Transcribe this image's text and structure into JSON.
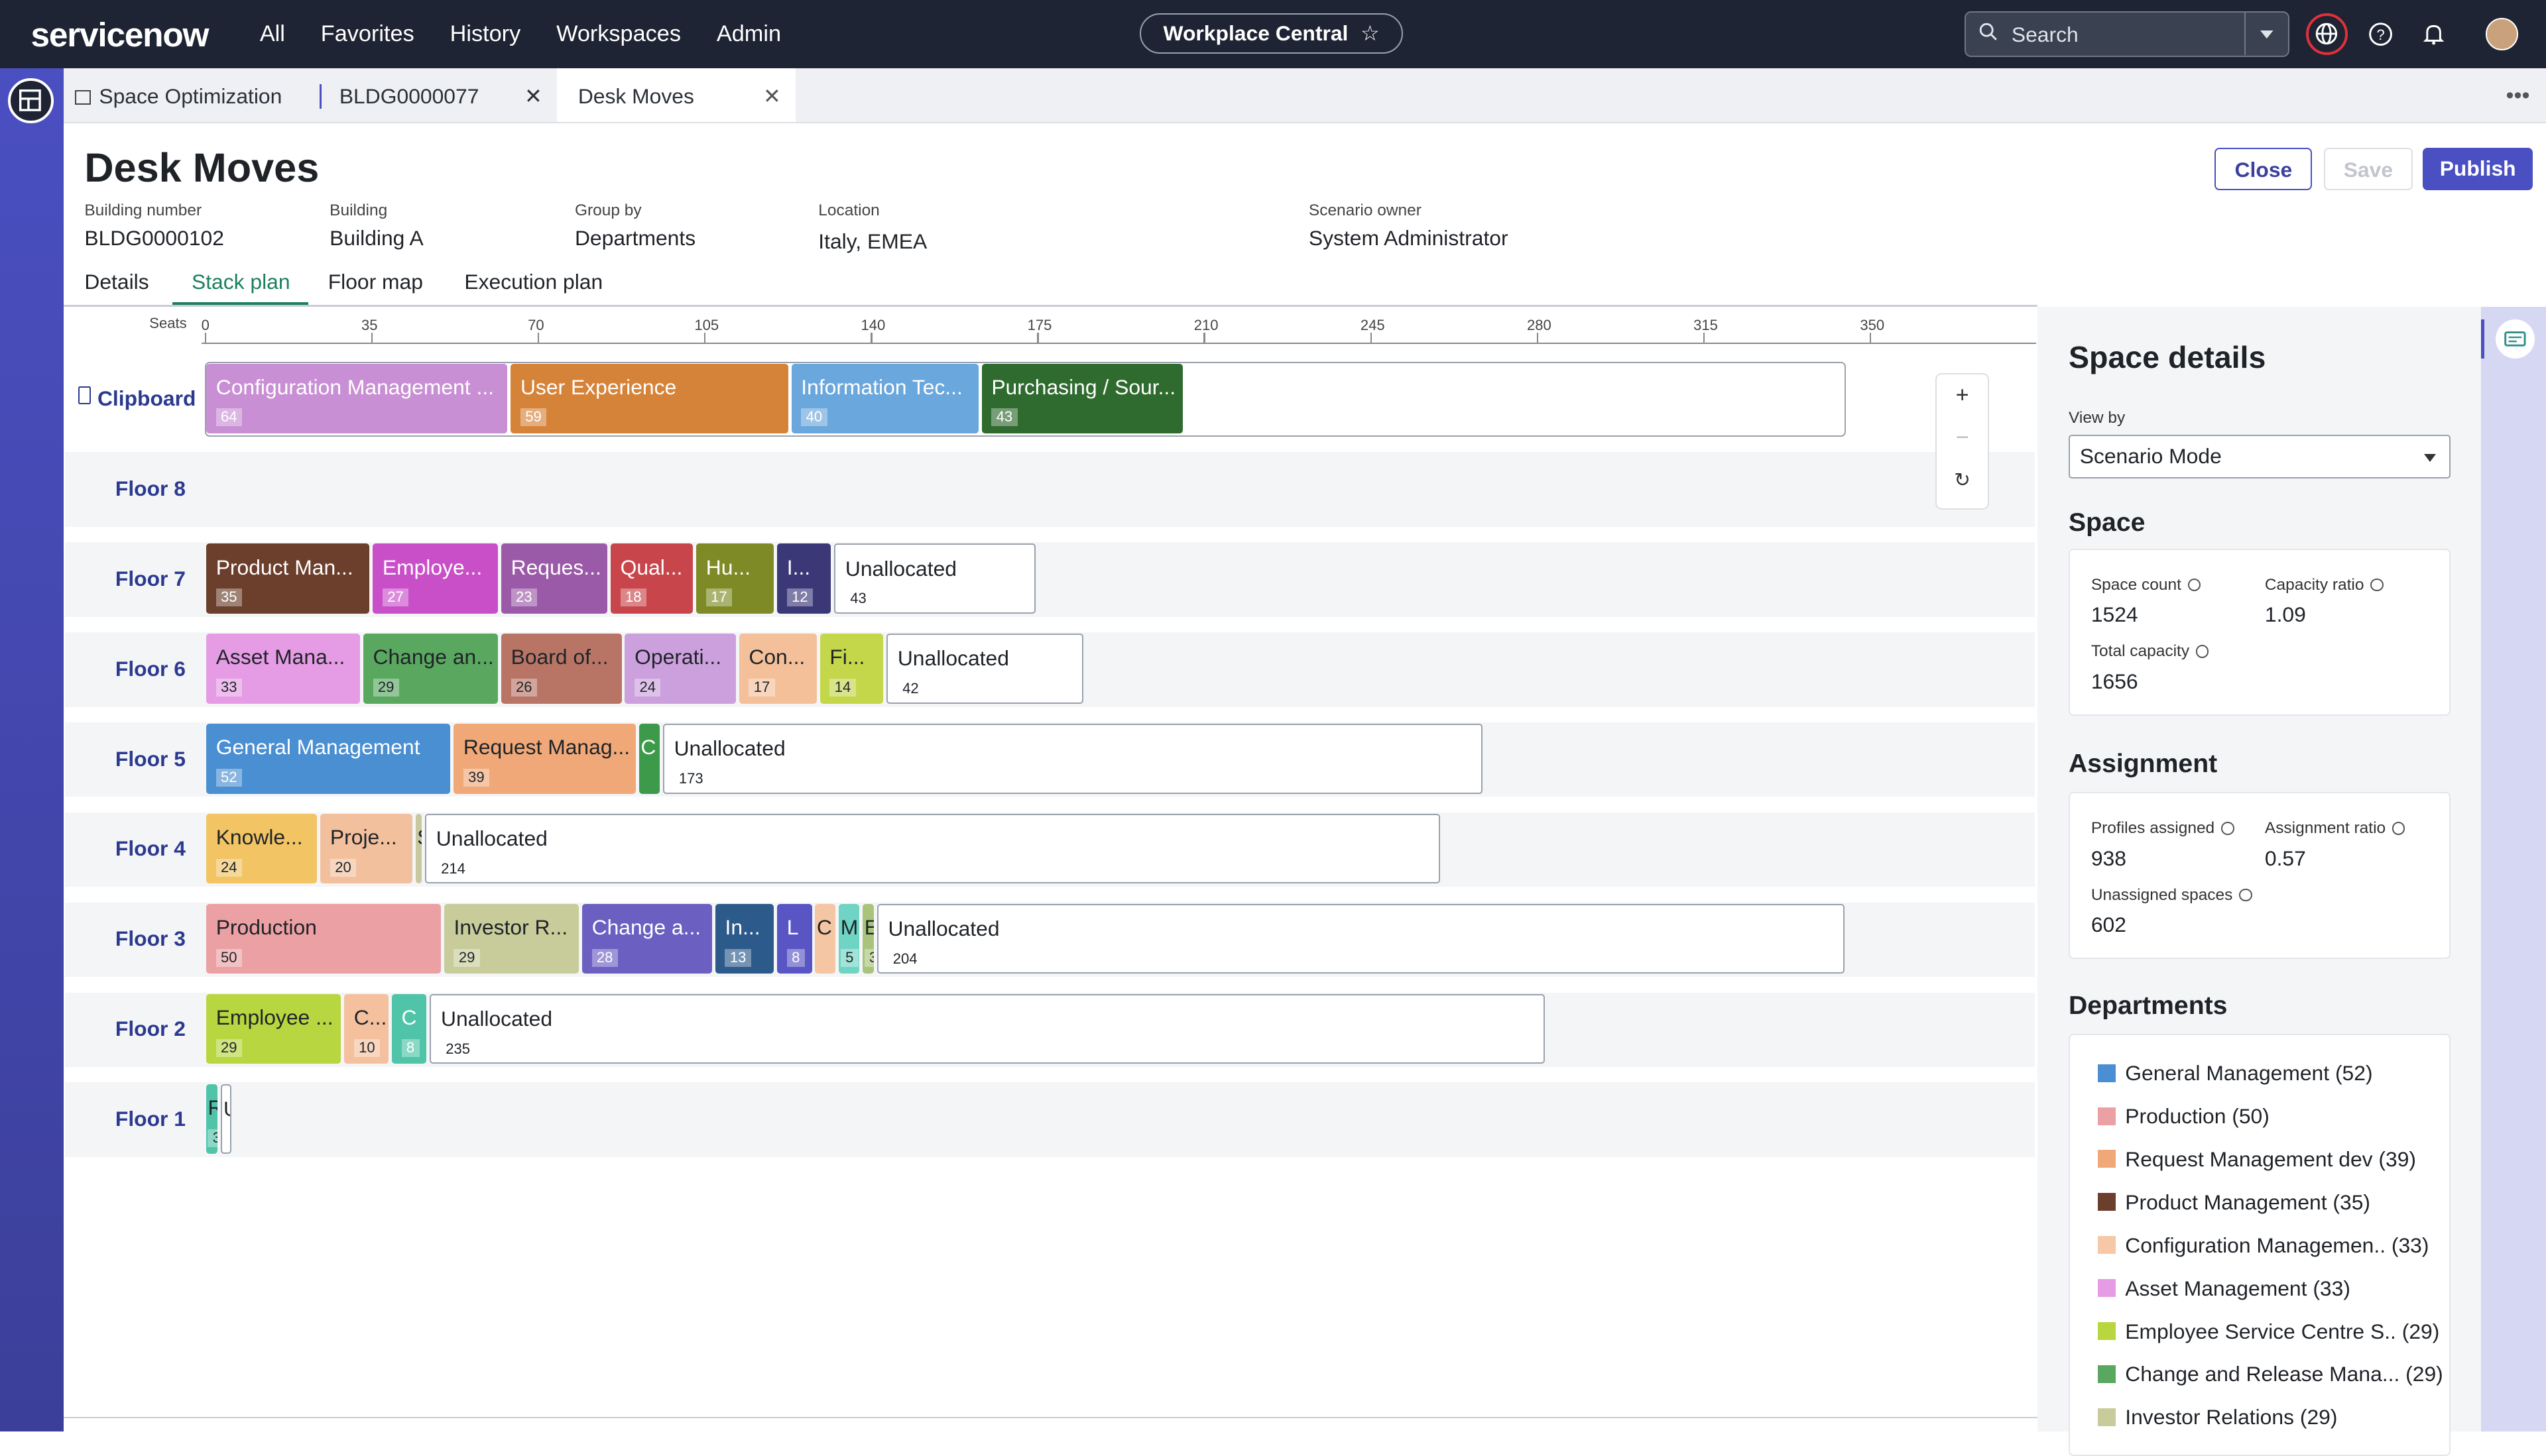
{
  "nav": {
    "logo": "servicenow",
    "menu": [
      "All",
      "Favorites",
      "History",
      "Workspaces",
      "Admin"
    ],
    "workspace": "Workplace Central",
    "search_placeholder": "Search"
  },
  "tabs": [
    {
      "label": "Space Optimization",
      "closable": false
    },
    {
      "label": "BLDG0000077",
      "closable": true
    },
    {
      "label": "Desk Moves",
      "closable": true,
      "active": true
    }
  ],
  "page": {
    "title": "Desk Moves",
    "buttons": {
      "close": "Close",
      "save": "Save",
      "publish": "Publish"
    },
    "fields": [
      {
        "label": "Building number",
        "value": "BLDG0000102"
      },
      {
        "label": "Building",
        "value": "Building A"
      },
      {
        "label": "Group by",
        "value": "Departments"
      },
      {
        "label": "Location",
        "value": "Italy, EMEA"
      },
      {
        "label": "Scenario owner",
        "value": "System Administrator"
      }
    ],
    "subtabs": [
      "Details",
      "Stack plan",
      "Floor map",
      "Execution plan"
    ],
    "active_subtab": "Stack plan"
  },
  "stack_plan": {
    "axis_label": "Seats",
    "ticks": [
      "0",
      "35",
      "70",
      "105",
      "140",
      "175",
      "210",
      "245",
      "280",
      "315",
      "350"
    ],
    "rows": [
      {
        "label": "Clipboard",
        "capacity": 345,
        "blocks": [
          {
            "name": "Configuration Management ...",
            "count": "64",
            "seats": 64,
            "color": "#c98fd4"
          },
          {
            "name": "User Experience",
            "count": "59",
            "seats": 59,
            "color": "#d6833a"
          },
          {
            "name": "Information Tec...",
            "count": "40",
            "seats": 40,
            "color": "#6aa7dc"
          },
          {
            "name": "Purchasing / Sour...",
            "count": "43",
            "seats": 43,
            "color": "#2f6b2f"
          }
        ]
      },
      {
        "label": "Floor 8",
        "capacity": 0,
        "blocks": []
      },
      {
        "label": "Floor 7",
        "capacity": 175,
        "blocks": [
          {
            "name": "Product Man...",
            "count": "35",
            "seats": 35,
            "color": "#6b3f2c"
          },
          {
            "name": "Employe...",
            "count": "27",
            "seats": 27,
            "color": "#c94fc9"
          },
          {
            "name": "Reques...",
            "count": "23",
            "seats": 23,
            "color": "#9b5aa8"
          },
          {
            "name": "Qual...",
            "count": "18",
            "seats": 18,
            "color": "#c8464b"
          },
          {
            "name": "Hu...",
            "count": "17",
            "seats": 17,
            "color": "#7e8a26"
          },
          {
            "name": "I...",
            "count": "12",
            "seats": 12,
            "color": "#3b3878"
          },
          {
            "name": "Unallocated",
            "count": "43",
            "seats": 43,
            "unallocated": true
          }
        ]
      },
      {
        "label": "Floor 6",
        "capacity": 185,
        "blocks": [
          {
            "name": "Asset Mana...",
            "count": "33",
            "seats": 33,
            "color": "#e59ce4",
            "dark": true
          },
          {
            "name": "Change an...",
            "count": "29",
            "seats": 29,
            "color": "#5aa860",
            "dark": true
          },
          {
            "name": "Board of...",
            "count": "26",
            "seats": 26,
            "color": "#b87566",
            "dark": true
          },
          {
            "name": "Operati...",
            "count": "24",
            "seats": 24,
            "color": "#cba0dc",
            "dark": true
          },
          {
            "name": "Con...",
            "count": "17",
            "seats": 17,
            "color": "#f4c09a",
            "dark": true
          },
          {
            "name": "Fi...",
            "count": "14",
            "seats": 14,
            "color": "#c4d64a",
            "dark": true
          },
          {
            "name": "Unallocated",
            "count": "42",
            "seats": 42,
            "unallocated": true
          }
        ]
      },
      {
        "label": "Floor 5",
        "capacity": 270,
        "blocks": [
          {
            "name": "General Management",
            "count": "52",
            "seats": 52,
            "color": "#4a8fd2"
          },
          {
            "name": "Request Manag...",
            "count": "39",
            "seats": 39,
            "color": "#f0a878",
            "dark": true
          },
          {
            "name": "C",
            "count": "",
            "seats": 5,
            "color": "#3d9a4a"
          },
          {
            "name": "Unallocated",
            "count": "173",
            "seats": 173,
            "unallocated": true
          }
        ]
      },
      {
        "label": "Floor 4",
        "capacity": 260,
        "blocks": [
          {
            "name": "Knowle...",
            "count": "24",
            "seats": 24,
            "color": "#f2c464",
            "dark": true
          },
          {
            "name": "Proje...",
            "count": "20",
            "seats": 20,
            "color": "#f3c09e",
            "dark": true
          },
          {
            "name": "S",
            "count": "",
            "seats": 2,
            "color": "#c8c9a0",
            "dark": true
          },
          {
            "name": "Unallocated",
            "count": "214",
            "seats": 214,
            "unallocated": true
          }
        ]
      },
      {
        "label": "Floor 3",
        "capacity": 345,
        "blocks": [
          {
            "name": "Production",
            "count": "50",
            "seats": 50,
            "color": "#eba0a3",
            "dark": true
          },
          {
            "name": "Investor R...",
            "count": "29",
            "seats": 29,
            "color": "#c7cc9a",
            "dark": true
          },
          {
            "name": "Change a...",
            "count": "28",
            "seats": 28,
            "color": "#6c5fc2"
          },
          {
            "name": "In...",
            "count": "13",
            "seats": 13,
            "color": "#2c5a8a"
          },
          {
            "name": "L",
            "count": "8",
            "seats": 8,
            "color": "#5a55c4"
          },
          {
            "name": "C",
            "count": "",
            "seats": 5,
            "color": "#f4c6a4",
            "dark": true
          },
          {
            "name": "M",
            "count": "5",
            "seats": 5,
            "color": "#6fd4c4",
            "dark": true
          },
          {
            "name": "E",
            "count": "3",
            "seats": 3,
            "color": "#a9c47a",
            "dark": true
          },
          {
            "name": "Unallocated",
            "count": "204",
            "seats": 204,
            "unallocated": true
          }
        ]
      },
      {
        "label": "Floor 2",
        "capacity": 283,
        "blocks": [
          {
            "name": "Employee ...",
            "count": "29",
            "seats": 29,
            "color": "#b8d640",
            "dark": true
          },
          {
            "name": "C...",
            "count": "10",
            "seats": 10,
            "color": "#f4c09e",
            "dark": true
          },
          {
            "name": "C",
            "count": "8",
            "seats": 8,
            "color": "#4fc4a8"
          },
          {
            "name": "Unallocated",
            "count": "235",
            "seats": 235,
            "unallocated": true
          }
        ]
      },
      {
        "label": "Floor 1",
        "capacity": 6,
        "blocks": [
          {
            "name": "R",
            "count": "3",
            "seats": 3,
            "color": "#4fc4a8",
            "dark": true
          },
          {
            "name": "U",
            "count": "",
            "seats": 3,
            "unallocated": true
          }
        ]
      }
    ],
    "zoom": {
      "plus": "+",
      "minus": "−",
      "reset": "↻"
    }
  },
  "panel": {
    "title": "Space details",
    "view_by_label": "View by",
    "view_by_value": "Scenario Mode",
    "space": {
      "heading": "Space",
      "space_count_label": "Space count",
      "space_count": "1524",
      "capacity_ratio_label": "Capacity ratio",
      "capacity_ratio": "1.09",
      "total_capacity_label": "Total capacity",
      "total_capacity": "1656"
    },
    "assignment": {
      "heading": "Assignment",
      "profiles_label": "Profiles assigned",
      "profiles": "938",
      "ratio_label": "Assignment ratio",
      "ratio": "0.57",
      "unassigned_label": "Unassigned spaces",
      "unassigned": "602"
    },
    "departments": {
      "heading": "Departments",
      "items": [
        {
          "label": "General Management (52)",
          "color": "#4a8fd2"
        },
        {
          "label": "Production (50)",
          "color": "#eba0a3"
        },
        {
          "label": "Request Management dev (39)",
          "color": "#f0a878"
        },
        {
          "label": "Product Management (35)",
          "color": "#6b3f2c"
        },
        {
          "label": "Configuration Managemen.. (33)",
          "color": "#f6c8a8"
        },
        {
          "label": "Asset Management (33)",
          "color": "#e59ce4"
        },
        {
          "label": "Employee Service Centre S.. (29)",
          "color": "#b8d640"
        },
        {
          "label": "Change and Release Mana... (29)",
          "color": "#5aa860"
        },
        {
          "label": "Investor Relations (29)",
          "color": "#c7cc9a"
        }
      ]
    }
  }
}
